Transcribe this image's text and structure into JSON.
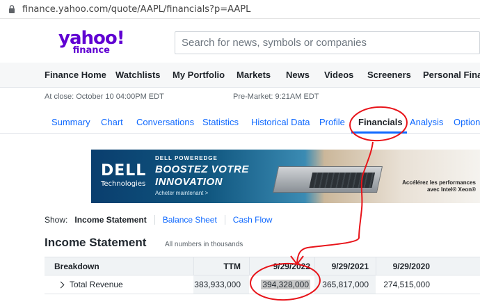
{
  "browser": {
    "url": "finance.yahoo.com/quote/AAPL/financials?p=AAPL"
  },
  "header": {
    "logo_main": "yahoo!",
    "logo_sub": "finance",
    "search_placeholder": "Search for news, symbols or companies"
  },
  "main_nav": [
    "Finance Home",
    "Watchlists",
    "My Portfolio",
    "Markets",
    "News",
    "Videos",
    "Screeners",
    "Personal Finance"
  ],
  "quote": {
    "at_close": "At close: October 10 04:00PM EDT",
    "pre_market": "Pre-Market: 9:21AM EDT"
  },
  "tabs": [
    "Summary",
    "Chart",
    "Conversations",
    "Statistics",
    "Historical Data",
    "Profile",
    "Financials",
    "Analysis",
    "Options"
  ],
  "active_tab": "Financials",
  "ad": {
    "brand": "DELL",
    "brand_sub": "Technologies",
    "kicker": "DELL POWEREDGE",
    "headline_1": "BOOSTEZ VOTRE",
    "headline_2": "INNOVATION",
    "cta": "Acheter maintenant >",
    "right_1": "Accélérez les performances",
    "right_2": "avec Intel® Xeon®"
  },
  "show": {
    "label": "Show:",
    "options": [
      "Income Statement",
      "Balance Sheet",
      "Cash Flow"
    ],
    "selected": "Income Statement"
  },
  "section": {
    "title": "Income Statement",
    "units_note": "All numbers in thousands"
  },
  "table": {
    "headers": [
      "Breakdown",
      "TTM",
      "9/29/2022",
      "9/29/2021",
      "9/29/2020"
    ],
    "rows": [
      {
        "label": "Total Revenue",
        "values": [
          "383,933,000",
          "394,328,000",
          "365,817,000",
          "274,515,000"
        ]
      }
    ]
  },
  "colors": {
    "brand_purple": "#6001d2",
    "link_blue": "#0f69ff",
    "annotation_red": "#e8141a"
  }
}
